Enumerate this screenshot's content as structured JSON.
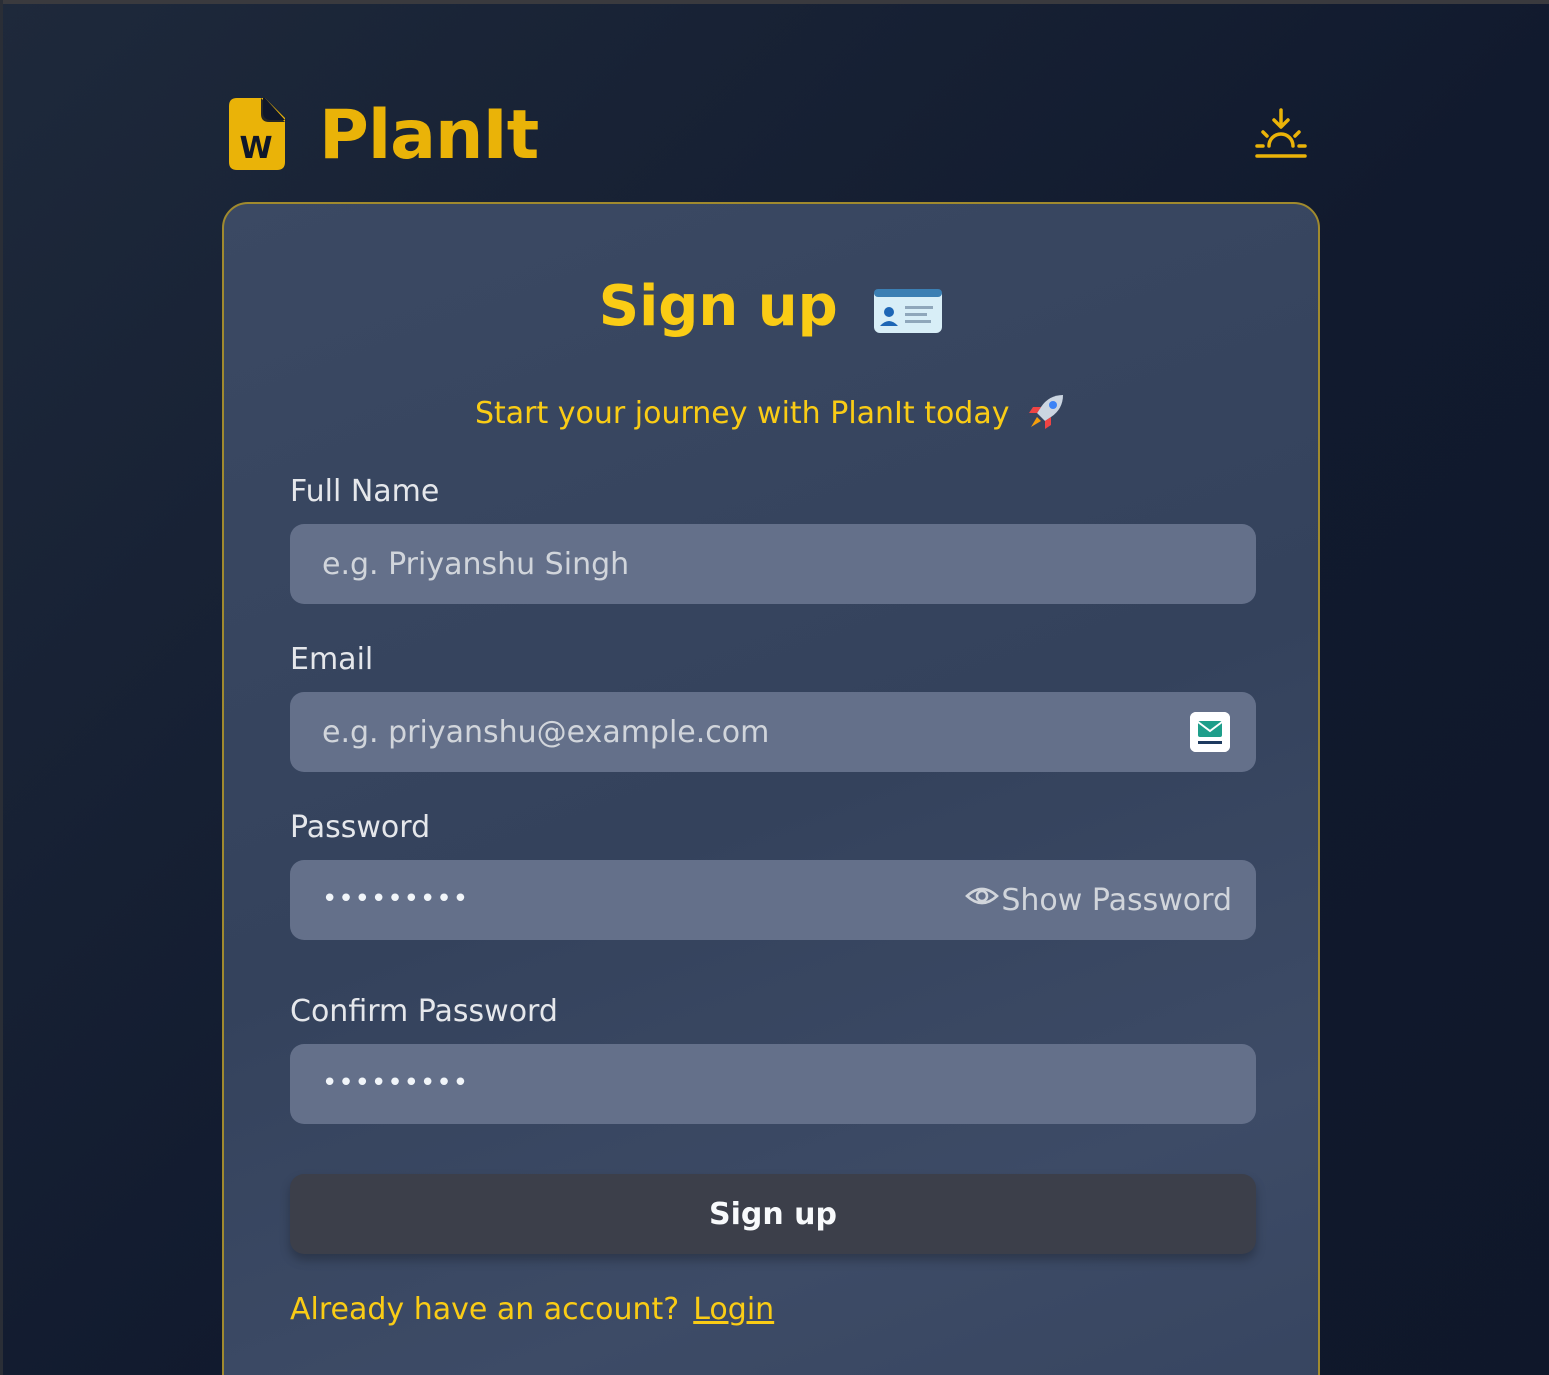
{
  "brand": {
    "name": "PlanIt",
    "accent_color": "#eab308",
    "logo_icon": "file-word-icon",
    "logo_letter": "W"
  },
  "header": {
    "theme_toggle_icon": "sunrise-icon"
  },
  "card": {
    "title": "Sign up",
    "title_icon": "id-card-icon",
    "subtitle": "Start your journey with PlanIt today",
    "subtitle_icon": "rocket-icon",
    "border_color": "#a08a2e"
  },
  "form": {
    "full_name": {
      "label": "Full Name",
      "placeholder": "e.g. Priyanshu Singh",
      "value": ""
    },
    "email": {
      "label": "Email",
      "placeholder": "e.g. priyanshu@example.com",
      "value": "",
      "extension_icon": "tempmail-icon"
    },
    "password": {
      "label": "Password",
      "masked_value": "•••••••••",
      "toggle_label": "Show Password",
      "toggle_icon": "eye-icon"
    },
    "confirm_password": {
      "label": "Confirm Password",
      "masked_value": "•••••••••"
    },
    "submit_label": "Sign up"
  },
  "footer": {
    "prompt": "Already have an account?",
    "link_label": "Login"
  }
}
